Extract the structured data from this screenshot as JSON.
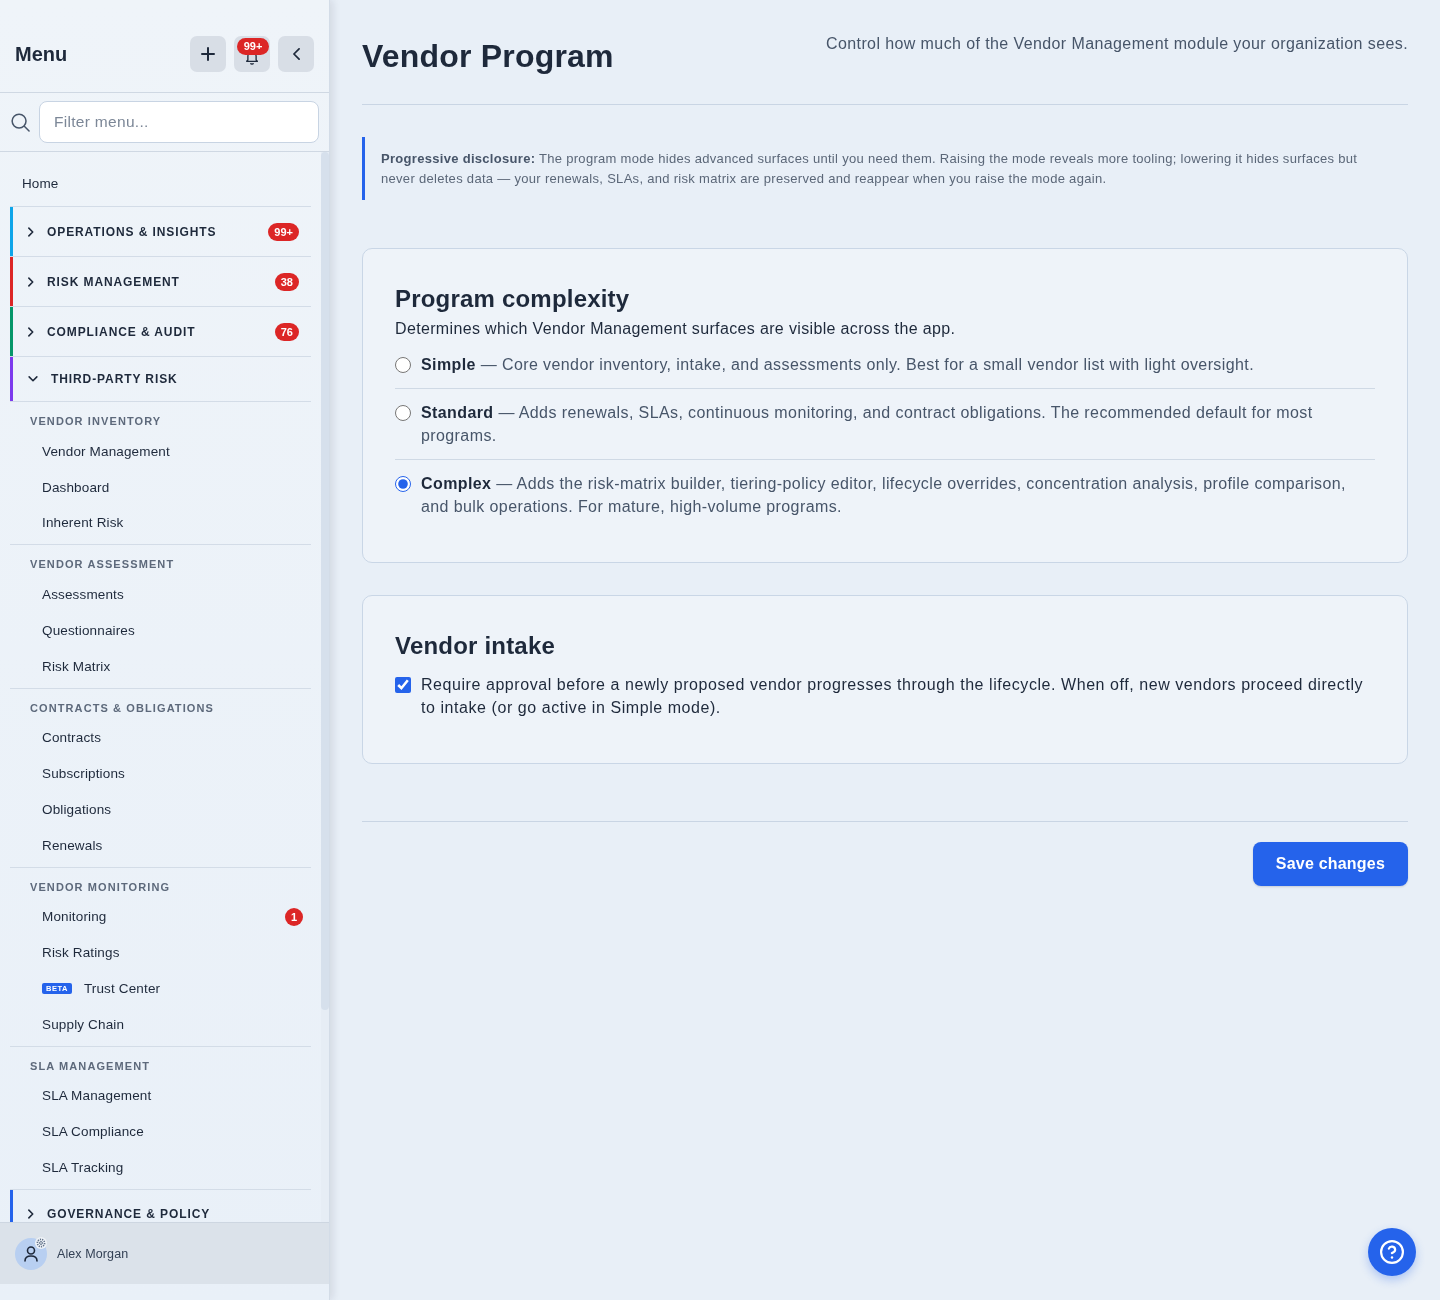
{
  "sidebar": {
    "title": "Menu",
    "notification_badge": "99+",
    "search": {
      "placeholder": "Filter menu..."
    },
    "items": [
      {
        "kind": "link",
        "label": "Home"
      },
      {
        "kind": "section",
        "label": "OPERATIONS & INSIGHTS",
        "color": "#0ea5e9",
        "expanded": false,
        "badge": "99+"
      },
      {
        "kind": "section",
        "label": "RISK MANAGEMENT",
        "color": "#dc2626",
        "expanded": false,
        "badge": "38"
      },
      {
        "kind": "section",
        "label": "COMPLIANCE & AUDIT",
        "color": "#059669",
        "expanded": false,
        "badge": "76"
      },
      {
        "kind": "section",
        "label": "THIRD-PARTY RISK",
        "color": "#7c3aed",
        "expanded": true,
        "children": [
          {
            "label": "VENDOR INVENTORY",
            "children": [
              {
                "label": "Vendor Management"
              },
              {
                "label": "Dashboard"
              },
              {
                "label": "Inherent Risk"
              }
            ]
          },
          {
            "label": "VENDOR ASSESSMENT",
            "children": [
              {
                "label": "Assessments"
              },
              {
                "label": "Questionnaires"
              },
              {
                "label": "Risk Matrix"
              }
            ]
          },
          {
            "label": "CONTRACTS & OBLIGATIONS",
            "children": [
              {
                "label": "Contracts"
              },
              {
                "label": "Subscriptions"
              },
              {
                "label": "Obligations"
              },
              {
                "label": "Renewals"
              }
            ]
          },
          {
            "label": "VENDOR MONITORING",
            "children": [
              {
                "label": "Monitoring",
                "badge": "1"
              },
              {
                "label": "Risk Ratings"
              },
              {
                "label": "Trust Center",
                "tag": "BETA"
              },
              {
                "label": "Supply Chain"
              }
            ]
          },
          {
            "label": "SLA MANAGEMENT",
            "children": [
              {
                "label": "SLA Management"
              },
              {
                "label": "SLA Compliance"
              },
              {
                "label": "SLA Tracking"
              }
            ]
          }
        ]
      },
      {
        "kind": "section",
        "label": "GOVERNANCE & POLICY",
        "color": "#2563eb",
        "expanded": false
      }
    ],
    "user": {
      "name": "Alex Morgan"
    }
  },
  "page": {
    "title": "Vendor Program",
    "subtitle": "Control how much of the Vendor Management module your organization sees."
  },
  "callout": {
    "text": "**Progressive disclosure:** The program mode hides advanced surfaces until you need them. Raising the mode reveals more tooling; lowering it hides surfaces but never deletes data — your renewals, SLAs, and risk matrix are preserved and reappear when you raise the mode again."
  },
  "cards": [
    {
      "kind": "radio_group",
      "title": "Program complexity",
      "description": "Determines which Vendor Management surfaces are visible across the app.",
      "options": [
        {
          "text": "**Simple** — Core vendor inventory, intake, and assessments only. Best for a small vendor list with light oversight.",
          "selected": false
        },
        {
          "text": "**Standard** — Adds renewals, SLAs, continuous monitoring, and contract obligations. The recommended default for most programs.",
          "selected": false
        },
        {
          "text": "**Complex** — Adds the risk-matrix builder, tiering-policy editor, lifecycle overrides, concentration analysis, profile comparison, and bulk operations. For mature, high-volume programs.",
          "selected": true
        }
      ]
    },
    {
      "kind": "checkbox",
      "title": "Vendor intake",
      "checkbox": {
        "label": "Require approval before a newly proposed vendor progresses through the lifecycle. When off, new vendors proceed directly to intake (or go active in Simple mode).",
        "checked": true
      }
    }
  ],
  "save_button": {
    "label": "Save changes"
  }
}
